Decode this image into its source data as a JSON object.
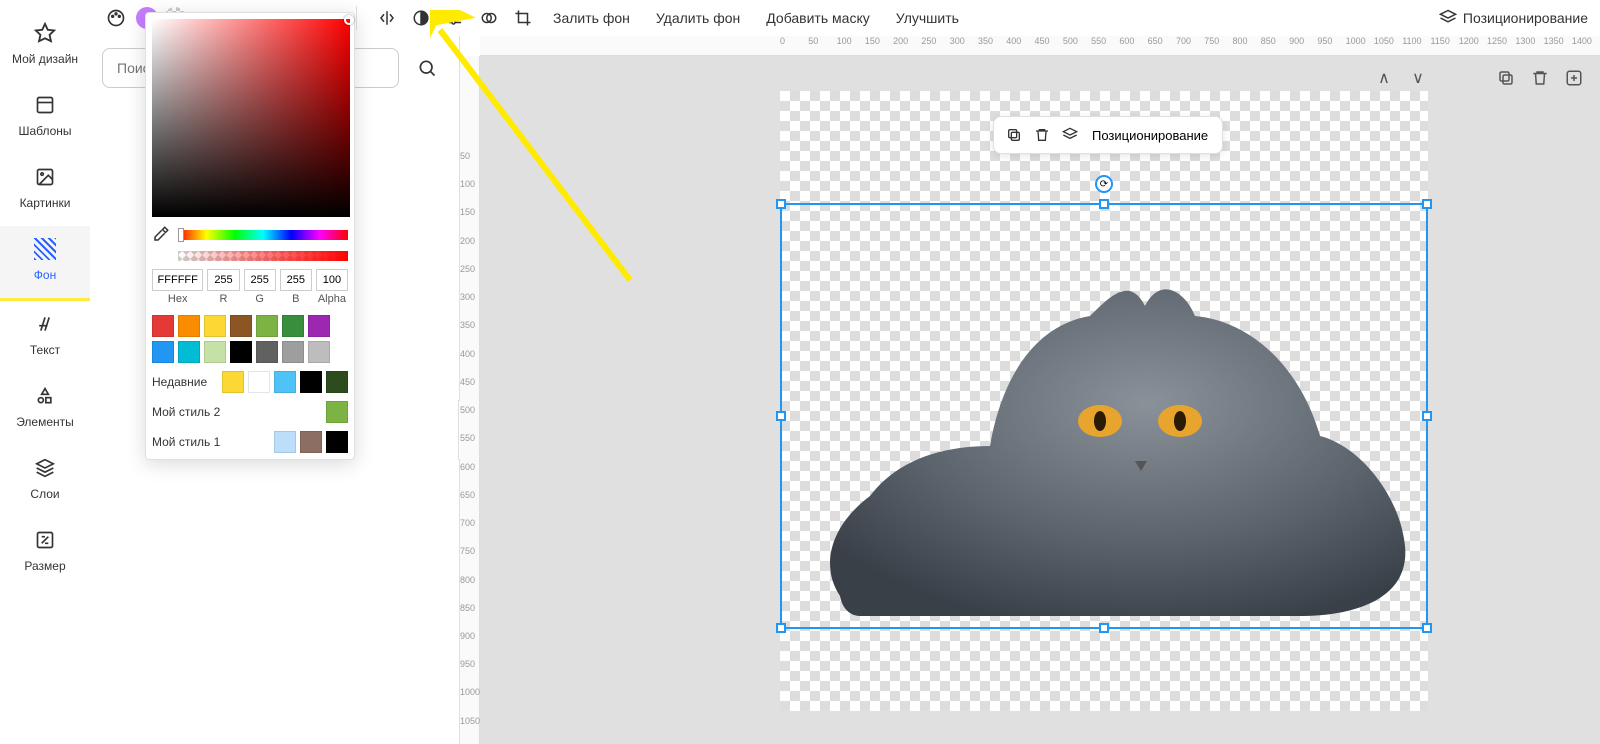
{
  "sidebar": [
    {
      "id": "my-design",
      "label": "Мой дизайн"
    },
    {
      "id": "templates",
      "label": "Шаблоны"
    },
    {
      "id": "images",
      "label": "Картинки"
    },
    {
      "id": "background",
      "label": "Фон"
    },
    {
      "id": "text",
      "label": "Текст"
    },
    {
      "id": "elements",
      "label": "Элементы"
    },
    {
      "id": "layers",
      "label": "Слои"
    },
    {
      "id": "size",
      "label": "Размер"
    }
  ],
  "search": {
    "placeholder": "Поиск"
  },
  "topbar": {
    "fill_bg": "Залить фон",
    "remove_bg": "Удалить фон",
    "add_mask": "Добавить маску",
    "enhance": "Улучшить",
    "positioning": "Позиционирование"
  },
  "selection_toolbar": {
    "positioning": "Позиционирование"
  },
  "color_picker": {
    "hex": "FFFFFF",
    "r": "255",
    "g": "255",
    "b": "255",
    "alpha": "100",
    "labels": {
      "hex": "Hex",
      "r": "R",
      "g": "G",
      "b": "B",
      "alpha": "Alpha"
    },
    "recent_label": "Недавние",
    "style1_label": "Мой стиль 2",
    "style2_label": "Мой стиль 1",
    "swatches": [
      "#e53935",
      "#fb8c00",
      "#fdd835",
      "#8d5524",
      "#7cb342",
      "#388e3c",
      "#9c27b0",
      "#2196f3",
      "#00bcd4",
      "#c5e1a5",
      "#000000",
      "#616161",
      "#9e9e9e",
      "#bdbdbd"
    ],
    "recent_swatches": [
      "#fdd835",
      "#ffffff",
      "#4fc3f7",
      "#000000",
      "#2e4b1e"
    ],
    "style1_swatches": [
      "#7cb342"
    ],
    "style2_swatches": [
      "#bbdefb",
      "#8d6e63",
      "#000000"
    ]
  },
  "ruler_h": [
    "0",
    "50",
    "100",
    "150",
    "200",
    "250",
    "300",
    "350",
    "400",
    "450",
    "500",
    "550",
    "600",
    "650",
    "700",
    "750",
    "800",
    "850",
    "900",
    "950",
    "1000",
    "1050",
    "1100",
    "1150",
    "1200",
    "1250",
    "1300",
    "1350",
    "1400"
  ],
  "ruler_v": [
    "50",
    "100",
    "150",
    "200",
    "250",
    "300",
    "350",
    "400",
    "450",
    "500",
    "550",
    "600",
    "650",
    "700",
    "750",
    "800",
    "850",
    "900",
    "950",
    "1000",
    "1050"
  ]
}
